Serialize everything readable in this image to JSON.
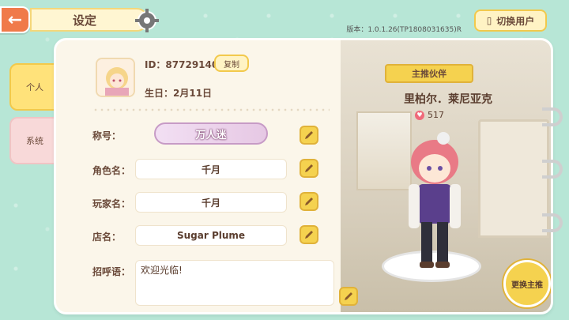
{
  "header": {
    "back_icon": "arrow-left-icon",
    "title": "设定",
    "version": "版本：1.0.1.26(TP1808031635)R",
    "switch_user": "切换用户"
  },
  "tabs": [
    {
      "label": "个人",
      "active": true
    },
    {
      "label": "系统",
      "active": false
    }
  ],
  "profile": {
    "id": "ID：87729140",
    "copy_label": "复制",
    "birthday": "生日：2月11日",
    "title_label": "称号：",
    "title_value": "万人迷",
    "role_label": "角色名：",
    "role_value": "千月",
    "player_label": "玩家名：",
    "player_value": "千月",
    "shop_label": "店名：",
    "shop_value": "Sugar Plume",
    "greeting_label": "招呼语：",
    "greeting_value": "欢迎光临!"
  },
  "partner": {
    "banner": "主推伙伴",
    "name": "里柏尔．莱尼亚克",
    "likes": "517",
    "swap_label": "更换主推"
  },
  "colors": {
    "accent_yellow": "#f5d24f",
    "back_orange": "#f07a4a",
    "bg_mint": "#b7e6d6"
  }
}
